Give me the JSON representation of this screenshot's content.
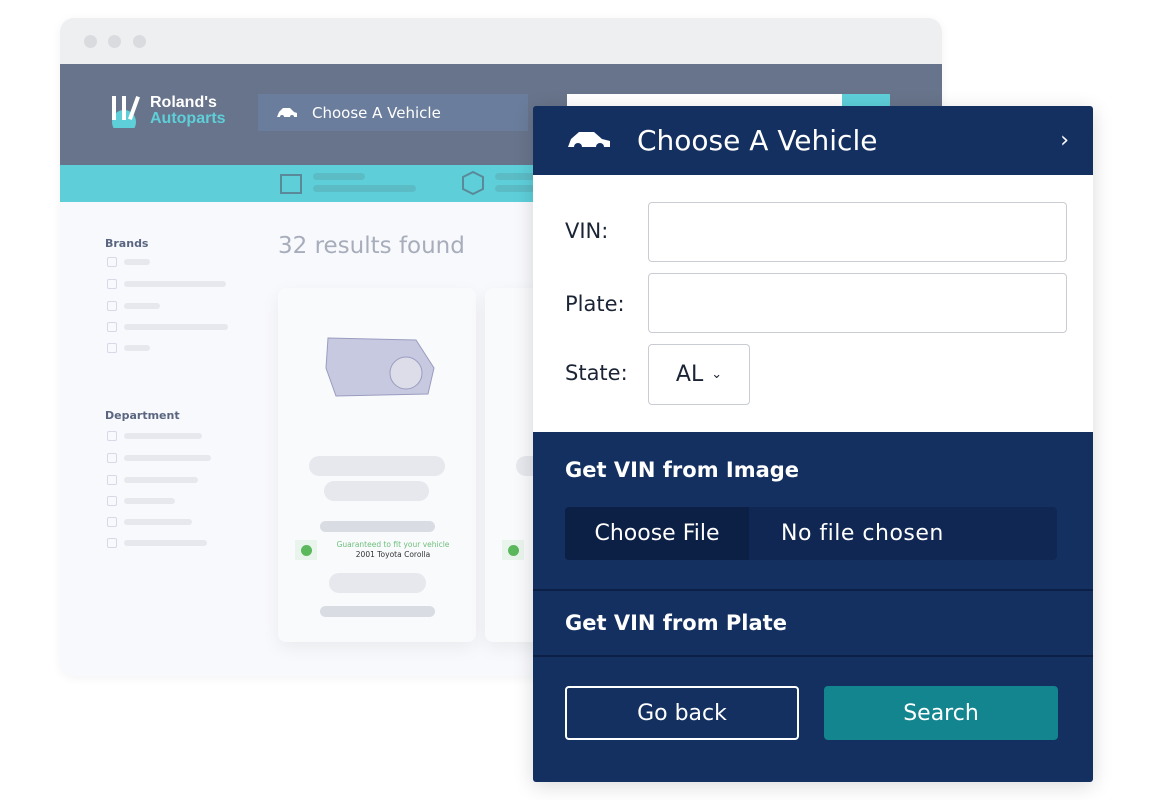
{
  "browser": {
    "logo_line1": "Roland's",
    "logo_line2": "Autoparts",
    "vehicle_selector": "Choose A Vehicle",
    "results": "32 results found",
    "sidebar": {
      "brands": "Brands",
      "department": "Department"
    },
    "card": {
      "guarantee": "Guaranteed to fit your vehicle",
      "vehicle": "2001 Toyota Corolla"
    }
  },
  "panel": {
    "title": "Choose A Vehicle",
    "chevron": "›",
    "vin_label": "VIN:",
    "vin_value": "",
    "plate_label": "Plate:",
    "plate_value": "",
    "state_label": "State:",
    "state_value": "AL",
    "vin_from_image": "Get VIN from Image",
    "choose_file": "Choose File",
    "no_file": "No file chosen",
    "vin_from_plate": "Get VIN from Plate",
    "go_back": "Go back",
    "search": "Search"
  },
  "colors": {
    "panel": "#143060",
    "accent": "#5ecfd9",
    "search_button": "#13858e",
    "topbar": "#68748b"
  }
}
